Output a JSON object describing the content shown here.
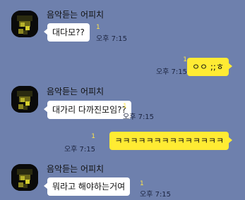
{
  "messages": [
    {
      "sender": "음악듣는 어피치",
      "text": "대다모??",
      "unread": "1",
      "time": "오후 7:15"
    },
    {
      "text": "ㅇㅇ ;;ㅎ",
      "unread": "1",
      "time": "오후 7:15"
    },
    {
      "sender": "음악듣는 어피치",
      "text": "대가리 다까진모임??",
      "unread": "1",
      "time": "오후 7:15"
    },
    {
      "text": "ㅋㅋㅋㅋㅋㅋㅋㅋㅋㅋㅋㅋㅋㅋ",
      "unread": "1",
      "time": "오후 7:15"
    },
    {
      "sender": "음악듣는 어피치",
      "text": "뭐라고 해야하는거여",
      "unread": "1",
      "time": "오후 7:15"
    }
  ]
}
